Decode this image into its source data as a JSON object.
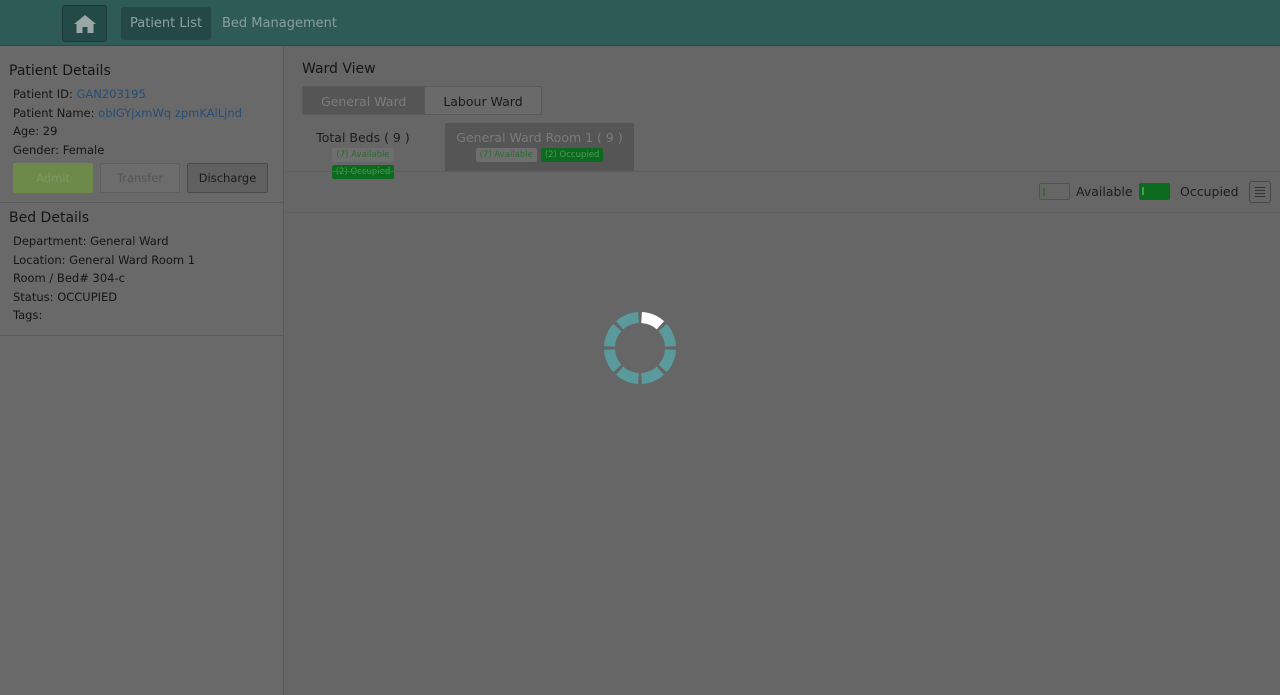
{
  "header": {
    "nav": [
      "Patient List",
      "Bed Management"
    ]
  },
  "patient": {
    "title": "Patient Details",
    "id_label": "Patient ID:",
    "id": "GAN203195",
    "name_label": "Patient Name:",
    "name": "obIGYjxmWq zpmKAlLjnd",
    "age_label": "Age:",
    "age": "29",
    "gender_label": "Gender:",
    "gender": "Female",
    "buttons": [
      "Admit",
      "Transfer",
      "Discharge"
    ]
  },
  "bed": {
    "title": "Bed Details",
    "department_label": "Department:",
    "department": "General Ward",
    "location_label": "Location:",
    "location": "General Ward Room 1",
    "room_label": "Room / Bed#",
    "room": "304-c",
    "status_label": "Status:",
    "status": "OCCUPIED",
    "tags_label": "Tags:"
  },
  "ward": {
    "title": "Ward View",
    "tabs": [
      "General Ward",
      "Labour Ward"
    ],
    "total": {
      "label": "Total Beds ( 9 )",
      "available": "(7) Available",
      "occupied": "(2) Occupied"
    },
    "room": {
      "label": "General Ward Room 1 ( 9 )",
      "available": "(7) Available",
      "occupied": "(2) Occupied"
    },
    "legend": {
      "available": "Available",
      "occupied": "Occupied"
    }
  },
  "colors": {
    "occupied": "#0c6a1e",
    "spinner": "#5a9a9c"
  }
}
